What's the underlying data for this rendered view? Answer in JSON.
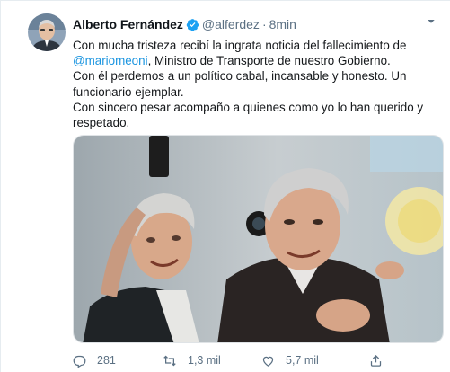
{
  "tweet": {
    "author_name": "Alberto Fernández",
    "handle": "@alferdez",
    "separator": "·",
    "time": "8min",
    "paragraphs": {
      "p1": "Con mucha tristeza recibí la ingrata noticia del fallecimiento de",
      "mention": "@mariomeoni",
      "p2_rest": ", Ministro de Transporte de nuestro Gobierno.",
      "p3": "Con él perdemos a un político cabal, incansable y honesto. Un funcionario ejemplar.",
      "p4": "Con sincero pesar acompaño a quienes como yo lo han querido y respetado."
    },
    "counts": {
      "replies": "281",
      "retweets": "1,3 mil",
      "likes": "5,7 mil"
    }
  },
  "colors": {
    "accent": "#1b95e0",
    "verified": "#1da1f2",
    "muted": "#5b7083"
  },
  "icons": {
    "verified": "verified-badge-icon",
    "more": "more-options-icon",
    "reply": "reply-icon",
    "retweet": "retweet-icon",
    "like": "like-icon",
    "share": "share-icon"
  }
}
